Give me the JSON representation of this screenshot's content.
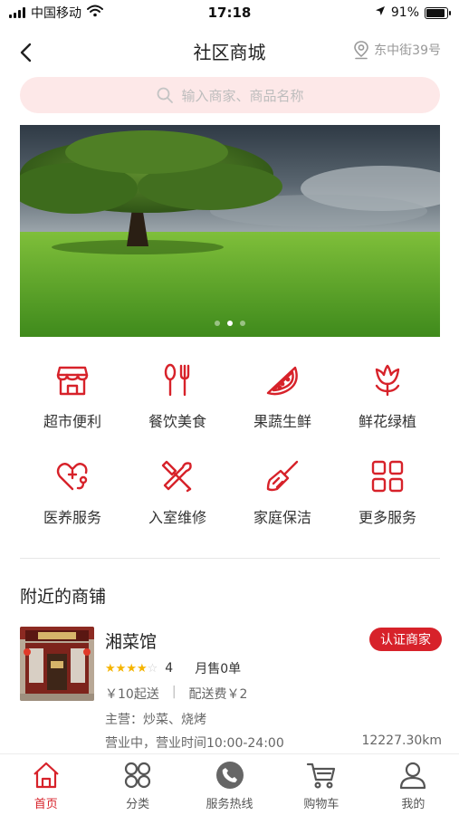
{
  "status_bar": {
    "carrier": "中国移动",
    "time": "17:18",
    "battery": "91%",
    "battery_level": 0.91
  },
  "nav": {
    "title": "社区商城",
    "location": "东中街39号"
  },
  "search": {
    "placeholder": "输入商家、商品名称"
  },
  "banner": {
    "dot_count": 3,
    "active_dot": 1
  },
  "categories": [
    {
      "label": "超市便利",
      "icon": "store-icon"
    },
    {
      "label": "餐饮美食",
      "icon": "utensils-icon"
    },
    {
      "label": "果蔬生鲜",
      "icon": "watermelon-icon"
    },
    {
      "label": "鲜花绿植",
      "icon": "flower-icon"
    },
    {
      "label": "医养服务",
      "icon": "stethoscope-icon"
    },
    {
      "label": "入室维修",
      "icon": "tools-icon"
    },
    {
      "label": "家庭保洁",
      "icon": "broom-icon"
    },
    {
      "label": "更多服务",
      "icon": "grid-icon"
    }
  ],
  "section": {
    "title": "附近的商铺"
  },
  "shop": {
    "name": "湘菜馆",
    "badge": "认证商家",
    "rating": 4,
    "rating_text": "4",
    "sales": "月售0单",
    "min_order": "￥10起送",
    "separator": "|",
    "delivery_fee": "配送费￥2",
    "main_business": "主营：炒菜、烧烤",
    "hours": "营业中，营业时间10:00-24:00",
    "distance": "12227.30km"
  },
  "tabs": [
    {
      "label": "首页",
      "icon": "home-icon",
      "active": true
    },
    {
      "label": "分类",
      "icon": "category-icon",
      "active": false
    },
    {
      "label": "服务热线",
      "icon": "phone-icon",
      "active": false
    },
    {
      "label": "购物车",
      "icon": "cart-icon",
      "active": false
    },
    {
      "label": "我的",
      "icon": "user-icon",
      "active": false
    }
  ],
  "colors": {
    "accent": "#d7222a",
    "search_bg": "#fde8e8",
    "star": "#f5b400"
  }
}
